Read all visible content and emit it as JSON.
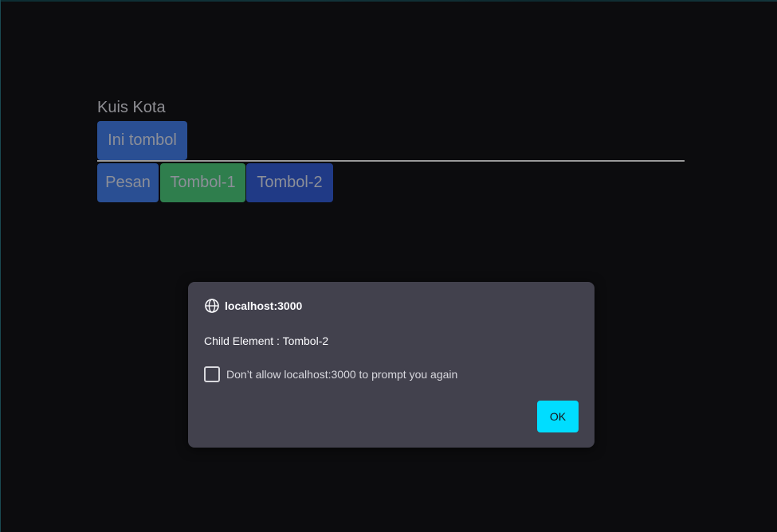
{
  "app": {
    "title": "Kuis Kota"
  },
  "buttons": {
    "ini_tombol": "Ini tombol",
    "pesan": "Pesan",
    "tombol_1": "Tombol-1",
    "tombol_2": "Tombol-2"
  },
  "dialog": {
    "origin": "localhost:3000",
    "message": "Child Element : Tombol-2",
    "checkbox_label": "Don’t allow localhost:3000 to prompt you again",
    "checkbox_checked": false,
    "ok_label": "OK"
  },
  "colors": {
    "background": "#0c0c0e",
    "button_blue": "#2a4f93",
    "button_green": "#2f7e4d",
    "button_navy": "#203a86",
    "dialog_bg": "#42414d",
    "ok_accent": "#00ddff"
  },
  "icons": {
    "dialog_origin": "globe-icon"
  }
}
